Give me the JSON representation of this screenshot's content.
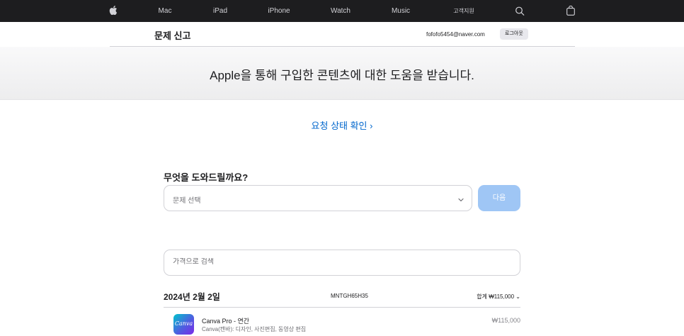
{
  "global_nav": {
    "items": [
      {
        "label": "Mac"
      },
      {
        "label": "iPad"
      },
      {
        "label": "iPhone"
      },
      {
        "label": "Watch"
      },
      {
        "label": "Music"
      },
      {
        "label": "고객지원"
      }
    ],
    "icons": [
      "apple-logo-icon",
      "search-icon",
      "shopping-bag-icon"
    ]
  },
  "local_nav": {
    "title": "문제 신고",
    "email": "fofofo5454@naver.com",
    "logout_label": "로그아웃"
  },
  "hero": {
    "heading": "Apple을 통해 구입한 콘텐츠에 대한 도움을 받습니다."
  },
  "status_link": "요청 상태 확인 ›",
  "help": {
    "question": "무엇을 도와드릴까요?",
    "select_value": "문제 선택",
    "next_label": "다음"
  },
  "search": {
    "placeholder": "가격으로 검색",
    "value": ""
  },
  "order": {
    "date": "2024년 2월 2일",
    "order_id": "MNTGH65H35",
    "total": "합계 ₩115,000 ⌄",
    "items": [
      {
        "logo_text": "Canva",
        "name": "Canva Pro - 연간",
        "subtitle": "Canva(캔바): 디자인, 사진편집, 동영상 편집",
        "price": "₩115,000"
      }
    ]
  },
  "colors": {
    "nav_bg": "#1d1d1f",
    "link": "#0066cc",
    "next_button_disabled": "#9fc6f5"
  }
}
